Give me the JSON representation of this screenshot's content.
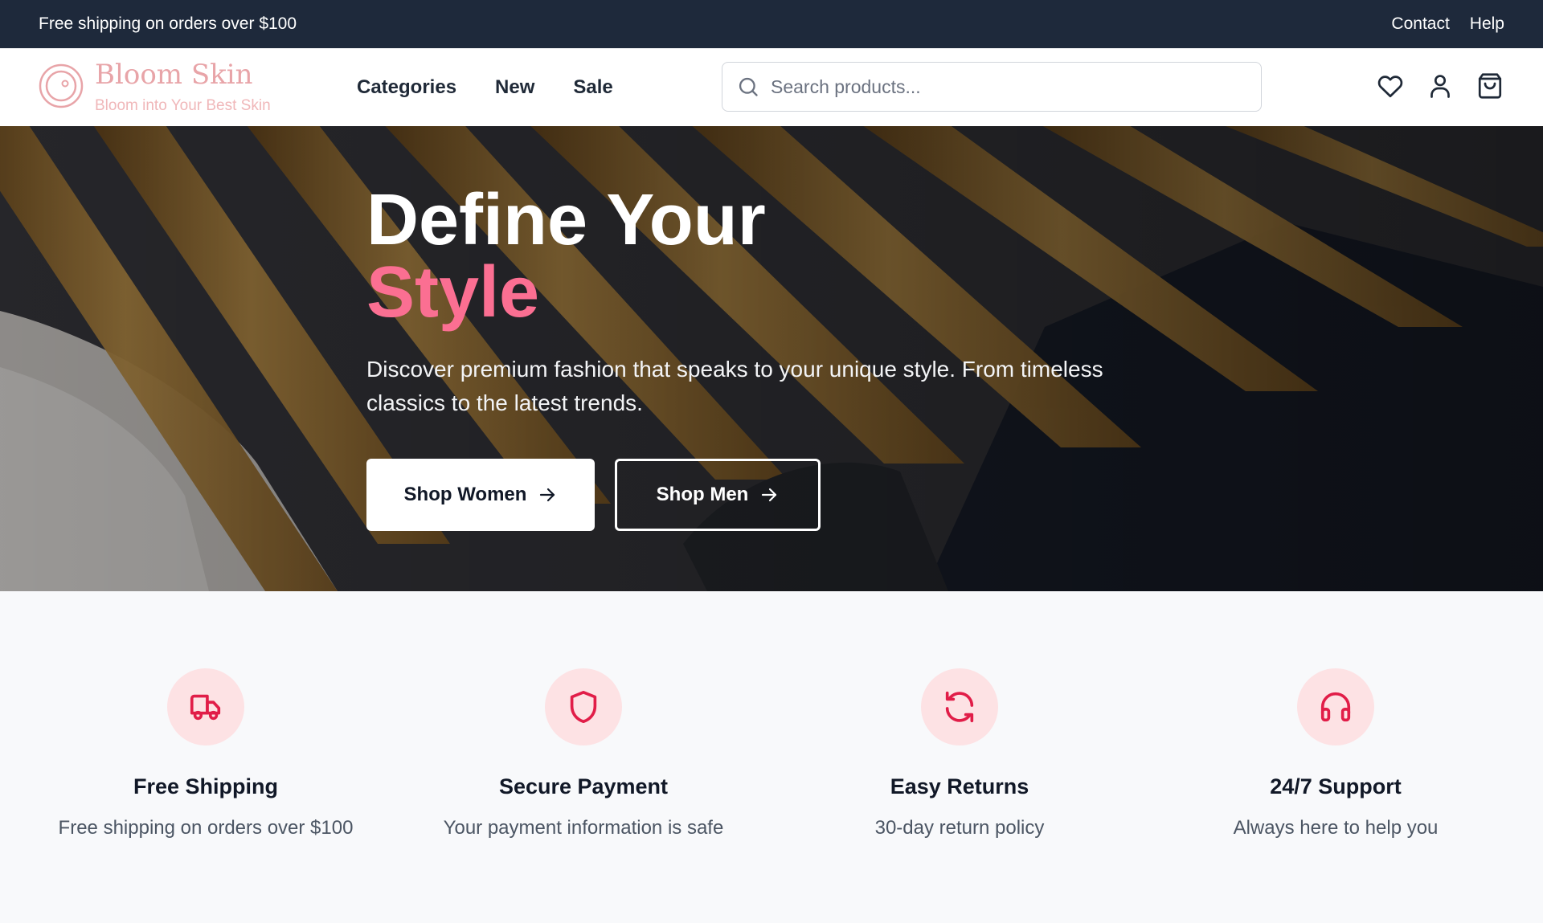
{
  "topbar": {
    "announcement": "Free shipping on orders over $100",
    "links": [
      "Contact",
      "Help"
    ]
  },
  "header": {
    "brand_name": "Bloom Skin",
    "brand_tagline": "Bloom into Your Best Skin",
    "nav": [
      "Categories",
      "New",
      "Sale"
    ],
    "search_placeholder": "Search products...",
    "icons": [
      "heart-icon",
      "user-icon",
      "shopping-bag-icon"
    ]
  },
  "hero": {
    "title_line1": "Define Your",
    "title_line2": "Style",
    "description": "Discover premium fashion that speaks to your unique style. From timeless classics to the latest trends.",
    "primary_button": "Shop Women",
    "secondary_button": "Shop Men"
  },
  "features": [
    {
      "icon": "truck-icon",
      "title": "Free Shipping",
      "desc": "Free shipping on orders over $100"
    },
    {
      "icon": "shield-icon",
      "title": "Secure Payment",
      "desc": "Your payment information is safe"
    },
    {
      "icon": "refresh-icon",
      "title": "Easy Returns",
      "desc": "30-day return policy"
    },
    {
      "icon": "headphones-icon",
      "title": "24/7 Support",
      "desc": "Always here to help you"
    }
  ],
  "colors": {
    "accent": "#fb6f92",
    "icon_accent": "#e11d48",
    "brand": "#e8a4a8",
    "topbar_bg": "#1e293b",
    "feature_circle_bg": "#fde2e4"
  }
}
